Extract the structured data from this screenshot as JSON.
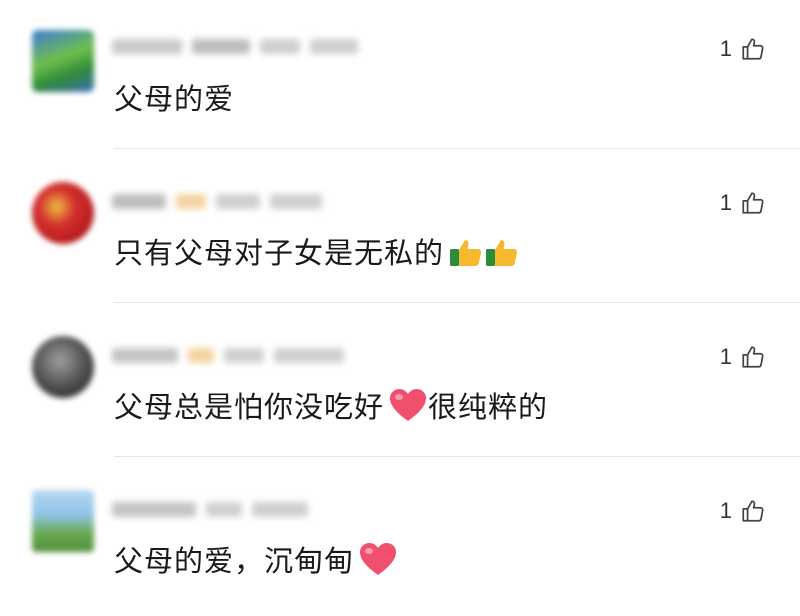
{
  "comments": [
    {
      "text": "父母的爱",
      "likes": "1",
      "emoji": []
    },
    {
      "text": "只有父母对子女是无私的",
      "likes": "1",
      "emoji": [
        "thumbs-up-icon",
        "thumbs-up-icon"
      ]
    },
    {
      "text": "父母总是怕你没吃好",
      "text_after": "很纯粹的",
      "likes": "1",
      "emoji": [
        "heart-icon"
      ]
    },
    {
      "text": "父母的爱，沉甸甸",
      "likes": "1",
      "emoji": [
        "heart-icon"
      ]
    }
  ],
  "colors": {
    "text": "#1a1a1a",
    "divider": "#e6e6e6",
    "heart": "#f0506e",
    "thumb_emoji": "#f5b82e"
  }
}
